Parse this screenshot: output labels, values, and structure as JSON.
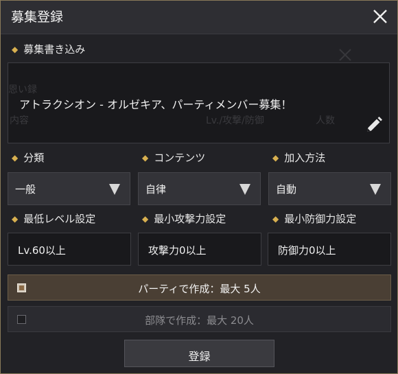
{
  "dialog": {
    "title": "募集登録",
    "close_icon": "close-icon"
  },
  "background_ghost": {
    "label1": "恩い録",
    "label2": "内容",
    "label3": "Lv./攻撃/防御",
    "label4": "人数"
  },
  "post": {
    "label": "募集書き込み",
    "text": "アトラクシオン - オルゼキア、パーティメンバー募集！",
    "edit_icon": "pencil-icon"
  },
  "category": {
    "label": "分類",
    "value": "一般"
  },
  "contents": {
    "label": "コンテンツ",
    "value": "自律"
  },
  "join": {
    "label": "加入方法",
    "value": "自動"
  },
  "min_level": {
    "label": "最低レベル設定",
    "value": "Lv.60以上"
  },
  "min_attack": {
    "label": "最小攻撃力設定",
    "value": "攻撃力0以上"
  },
  "min_defense": {
    "label": "最小防御力設定",
    "value": "防御力0以上"
  },
  "options": {
    "party": {
      "label": "パーティで作成：最大 5人",
      "checked": true
    },
    "troop": {
      "label": "部隊で作成：最大 20人",
      "checked": false
    }
  },
  "register_button": "登録",
  "colors": {
    "accent": "#d8b050",
    "frame": "#8a7a5a",
    "selected_row": "#4a3f34"
  }
}
